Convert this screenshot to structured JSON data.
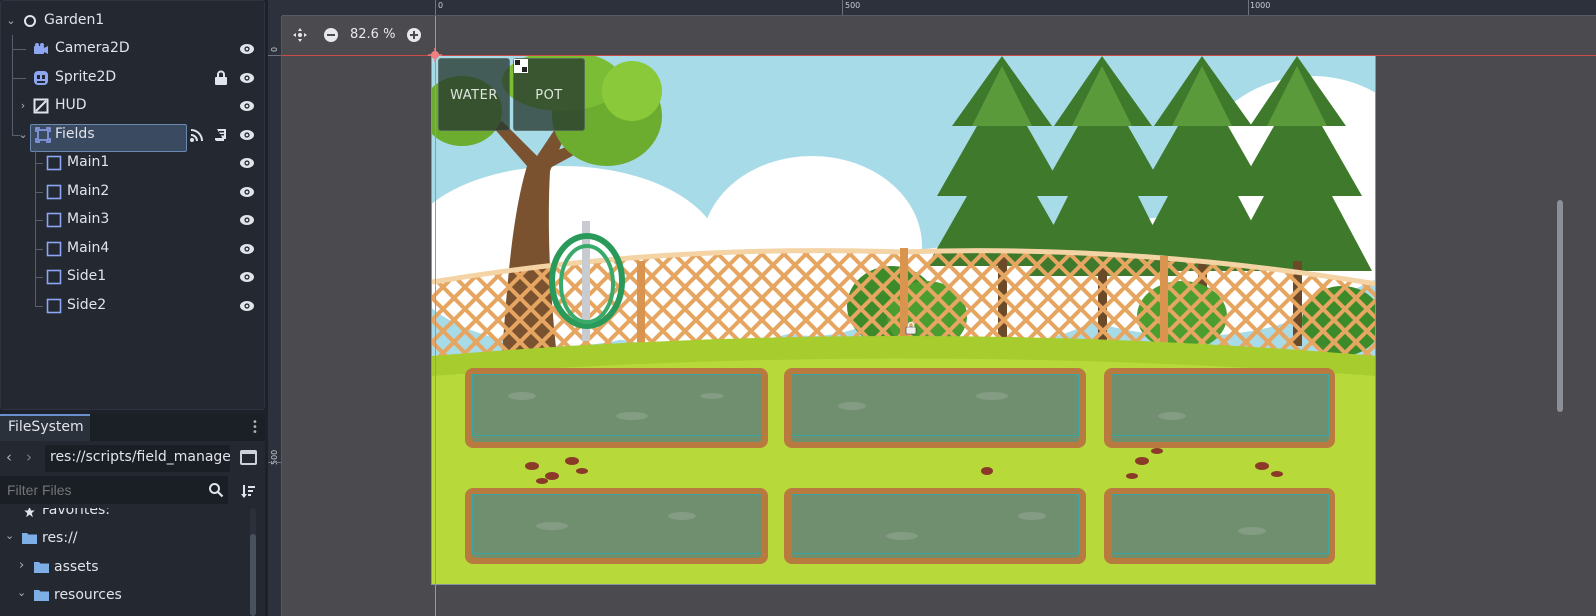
{
  "scene_tree": {
    "items": [
      {
        "name": "Garden1",
        "icon": "node-circle-icon"
      },
      {
        "name": "Camera2D",
        "icon": "camera-icon"
      },
      {
        "name": "Sprite2D",
        "icon": "sprite-icon"
      },
      {
        "name": "HUD",
        "icon": "canvas-layer-icon"
      },
      {
        "name": "Fields",
        "icon": "node2d-icon"
      },
      {
        "name": "Main1",
        "icon": "area-icon"
      },
      {
        "name": "Main2",
        "icon": "area-icon"
      },
      {
        "name": "Main3",
        "icon": "area-icon"
      },
      {
        "name": "Main4",
        "icon": "area-icon"
      },
      {
        "name": "Side1",
        "icon": "area-icon"
      },
      {
        "name": "Side2",
        "icon": "area-icon"
      }
    ],
    "selected": "Fields"
  },
  "filesystem": {
    "tab": "FileSystem",
    "path": "res://scripts/field_manage",
    "filter_placeholder": "Filter Files",
    "items": [
      {
        "label": "Favorites:",
        "icon": "star-icon"
      },
      {
        "label": "res://",
        "icon": "folder-icon"
      },
      {
        "label": "assets",
        "icon": "folder-icon"
      },
      {
        "label": "resources",
        "icon": "folder-icon"
      }
    ]
  },
  "viewport": {
    "zoom": "82.6 %",
    "ruler_top": [
      "0",
      "500",
      "1000"
    ],
    "ruler_left": [
      "0",
      "500"
    ],
    "hud_buttons": [
      "WATER",
      "POT"
    ]
  },
  "colors": {
    "accent": "#6a8fcf",
    "selection": "#3a4a60",
    "guide_red": "#d04a4a",
    "guide_green": "#7ab84a",
    "field_outline": "#3aa6a4"
  }
}
